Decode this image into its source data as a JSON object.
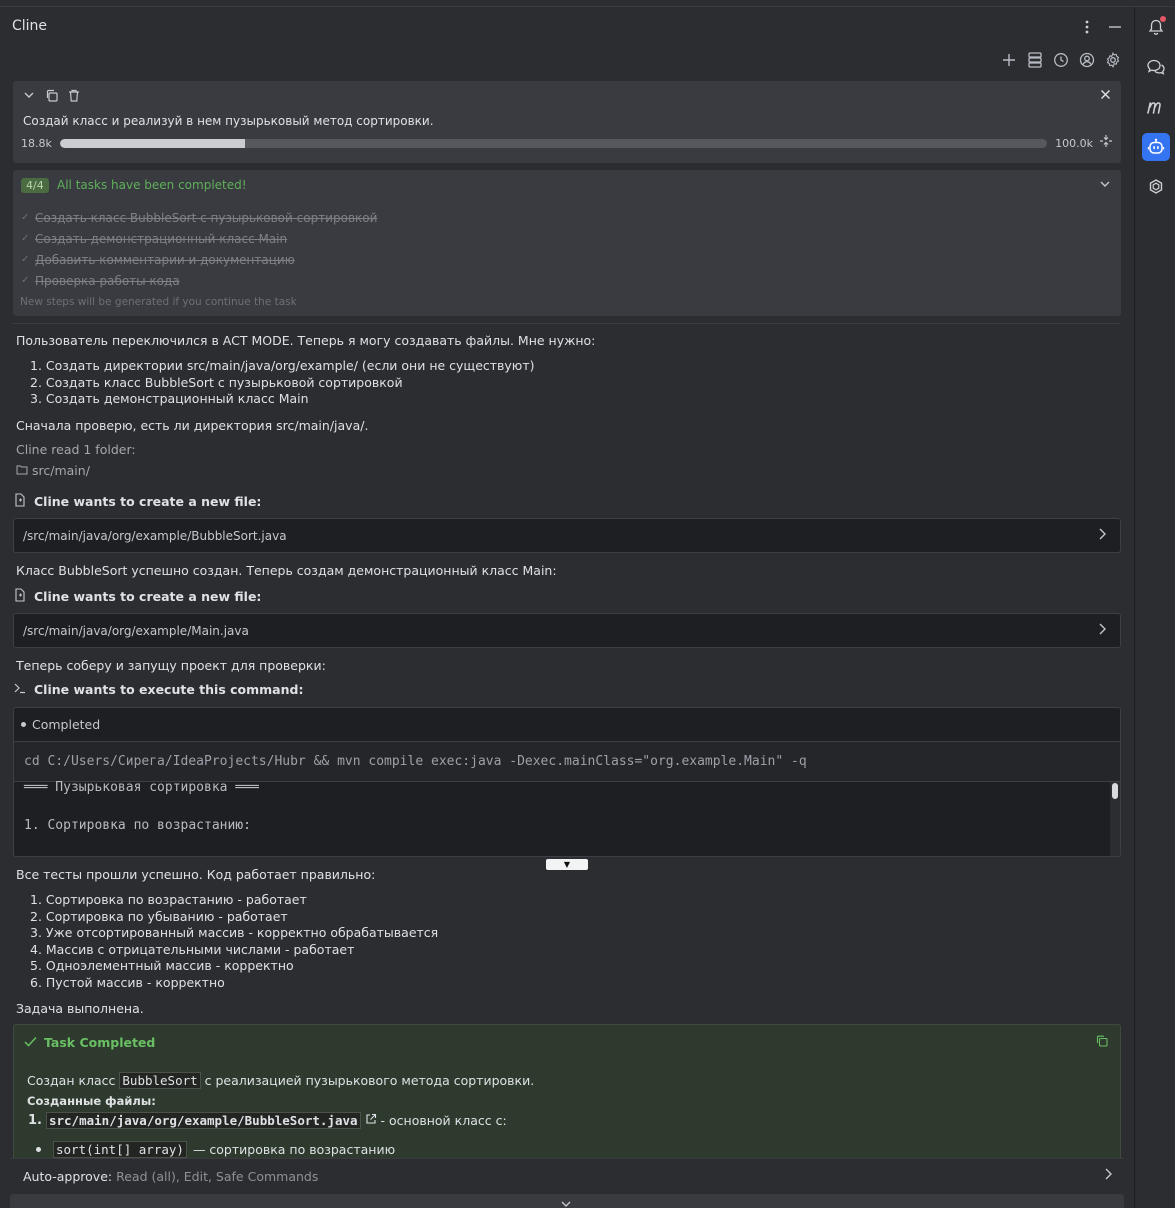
{
  "app": {
    "title": "Cline"
  },
  "task": {
    "text": "Создай класс и реализуй в нем пузырьковый метод сортировки.",
    "context_used_label": "18.8k",
    "context_max_label": "100.0k",
    "context_fraction": 0.188
  },
  "todo": {
    "badge": "4/4",
    "title": "All tasks have been completed!",
    "items": [
      "Создать класс BubbleSort с пузырьковой сортировкой",
      "Создать демонстрационный класс Main",
      "Добавить комментарии и документацию",
      "Проверка работы кода"
    ],
    "note": "New steps will be generated if you continue the task"
  },
  "messages": {
    "intro": "Пользователь переключился в ACT MODE. Теперь я могу создавать файлы. Мне нужно:",
    "plan": [
      "1. Создать директории src/main/java/org/example/ (если они не существуют)",
      "2. Создать класс BubbleSort с пузырьковой сортировкой",
      "3. Создать демонстрационный класс Main"
    ],
    "check_dir": "Сначала проверю, есть ли директория src/main/java/.",
    "read_folder": "Cline read 1 folder:",
    "folder": "src/main/",
    "create_file_1": "Cline wants to create a new file:",
    "file_1": "/src/main/java/org/example/BubbleSort.java",
    "after_file_1": "Класс BubbleSort успешно создан. Теперь создам демонстрационный класс Main:",
    "create_file_2": "Cline wants to create a new file:",
    "file_2": "/src/main/java/org/example/Main.java",
    "before_cmd": "Теперь соберу и запущу проект для проверки:",
    "exec_cmd": "Cline wants to execute this command:",
    "tests_ok": "Все тесты прошли успешно. Код работает правильно:",
    "tests": [
      "1. Сортировка по возрастанию - работает",
      "2. Сортировка по убыванию - работает",
      "3. Уже отсортированный массив - корректно обрабатывается",
      "4. Массив с отрицательными числами - работает",
      "5. Одноэлементный массив - корректно",
      "6. Пустой массив - корректно"
    ],
    "task_done": "Задача выполнена."
  },
  "command": {
    "status": "Completed",
    "line": "cd C:/Users/Сирега/IdeaProjects/Hubr && mvn compile exec:java -Dexec.mainClass=\"org.example.Main\" -q",
    "output_1": "═══ Пузырьковая сортировка ═══",
    "output_2": "1. Сортировка по возрастанию:",
    "expand_glyph": "▼"
  },
  "completion": {
    "title": "Task Completed",
    "p_before": "Создан класс ",
    "p_code": "BubbleSort",
    "p_after": " с реализацией пузырькового метода сортировки.",
    "files_heading": "Созданные файлы:",
    "file_num": "1.",
    "file_path": "src/main/java/org/example/BubbleSort.java",
    "file_desc": "- основной класс с:",
    "method_code": "sort(int[] array)",
    "method_desc": "— сортировка по возрастанию"
  },
  "auto_approve": {
    "label": "Auto-approve:",
    "value": "Read (all), Edit, Safe Commands"
  },
  "icons": {
    "toolbar": [
      "plus-icon",
      "database-icon",
      "history-icon",
      "account-icon",
      "gear-icon"
    ],
    "toolstrip": [
      "notifications-icon",
      "chat-icon",
      "m-plugin-icon",
      "cline-robot-icon",
      "openai-icon"
    ]
  },
  "colors": {
    "accent_blue": "#3574f0",
    "success_green": "#6abf64",
    "notification_dot": "#e55765"
  }
}
